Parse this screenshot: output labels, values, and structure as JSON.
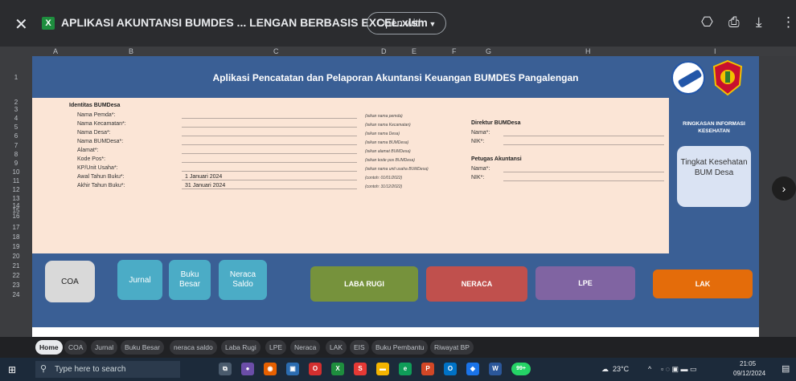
{
  "viewer": {
    "file_title": "APLIKASI AKUNTANSI BUMDES ... LENGAN BERBASIS EXCEL.xlsm",
    "open_with": "Open with",
    "file_badge": "X"
  },
  "columns": [
    "A",
    "B",
    "C",
    "D",
    "E",
    "F",
    "G",
    "H",
    "I"
  ],
  "rows": [
    "1",
    "2",
    "3",
    "4",
    "5",
    "6",
    "7",
    "8",
    "9",
    "10",
    "11",
    "12",
    "13",
    "14",
    "15",
    "16",
    "17",
    "18",
    "19",
    "20",
    "21",
    "22",
    "23",
    "24"
  ],
  "sheet": {
    "title": "Aplikasi Pencatatan dan Pelaporan Akuntansi Keuangan BUMDES Pangalengan",
    "identitas_heading": "Identitas BUMDesa",
    "fields": [
      {
        "label": "Nama Pemda*:",
        "value": "",
        "hint": "(isikan nama pemda)"
      },
      {
        "label": "Nama Kecamatan*:",
        "value": "",
        "hint": "(isikan nama Kecamatan)"
      },
      {
        "label": "Nama Desa*:",
        "value": "",
        "hint": "(isikan nama Desa)"
      },
      {
        "label": "Nama BUMDesa*:",
        "value": "",
        "hint": "(isikan nama BUMDesa)"
      },
      {
        "label": "Alamat*:",
        "value": "",
        "hint": "(isikan alamat BUMDesa)"
      },
      {
        "label": "Kode Pos*:",
        "value": "",
        "hint": "(isikan kode pos BUMDesa)"
      },
      {
        "label": "KP/Unit Usaha*:",
        "value": "",
        "hint": "(isikan nama unit usaha BUMDesa)"
      },
      {
        "label": "Awal Tahun Buku*:",
        "value": "1 Januari 2024",
        "hint": "(contoh: 01/01/2022)"
      },
      {
        "label": "Akhir Tahun Buku*:",
        "value": "31 Januari 2024",
        "hint": "(contoh: 31/12/2022)"
      }
    ],
    "direktur": {
      "heading": "Direktur BUMDesa",
      "nama": "Nama*:",
      "nik": "NIK*:"
    },
    "petugas": {
      "heading": "Petugas Akuntansi",
      "nama": "Nama*:",
      "nik": "NIK*:"
    },
    "ringkasan": "RINGKASAN INFORMASI KESEHATAN",
    "tingkat": "Tingkat Kesehatan BUM Desa"
  },
  "buttons": {
    "coa": "COA",
    "jurnal": "Jurnal",
    "buku_besar": "Buku Besar",
    "neraca_saldo": "Neraca Saldo",
    "laba_rugi": "LABA RUGI",
    "neraca": "NERACA",
    "lpe": "LPE",
    "lak": "LAK"
  },
  "tabs": [
    "Home",
    "COA",
    "Jurnal",
    "Buku Besar",
    "neraca saldo",
    "Laba Rugi",
    "LPE",
    "Neraca",
    "LAK",
    "EIS",
    "Buku Pembantu",
    "Riwayat BP"
  ],
  "taskbar": {
    "search_placeholder": "Type here to search",
    "badge": "99+",
    "weather": "23°C",
    "time": "21:05",
    "date": "09/12/2024"
  },
  "colors": {
    "sheet_bg": "#3a5f95",
    "panel_bg": "#fbe5d6",
    "coa": "#d9d9d9",
    "teal": "#4bacc6",
    "laba_rugi": "#76923c",
    "neraca": "#c0504d",
    "lpe": "#8064a2",
    "lak": "#e46c0a"
  }
}
